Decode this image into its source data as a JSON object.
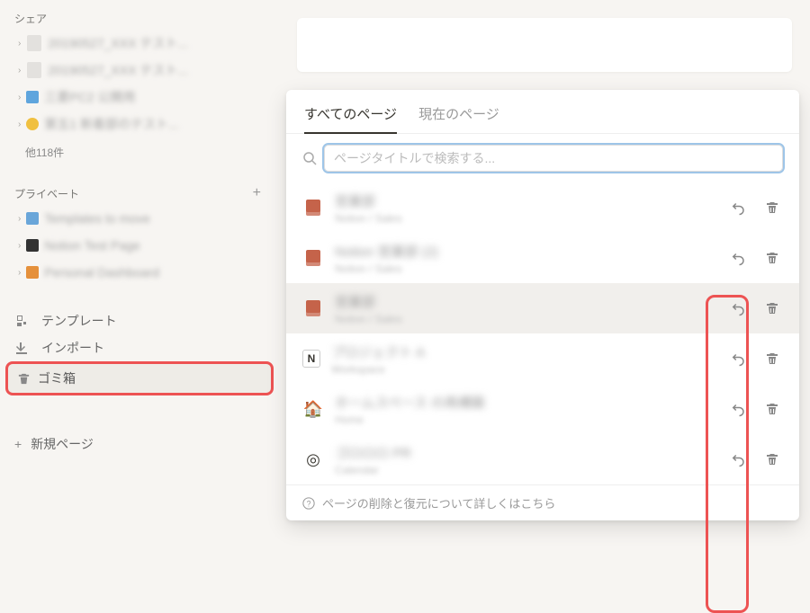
{
  "sidebar": {
    "share_label": "シェア",
    "share_items": [
      {
        "icon": "📄",
        "title": "20190527_XXX テスト..."
      },
      {
        "icon": "📄",
        "title": "20190527_XXX テスト..."
      },
      {
        "icon": "🟦",
        "title": "三菱PC2 公開用"
      },
      {
        "icon": "🟡",
        "title": "第五1 新着部のテスト..."
      }
    ],
    "other_count_label": "他118件",
    "private_label": "プライベート",
    "private_items": [
      {
        "icon": "🟦",
        "title": "Templates to move"
      },
      {
        "icon": "⬛",
        "title": "Notion Test Page"
      },
      {
        "icon": "🟧",
        "title": "Personal Dashboard"
      }
    ],
    "templates_label": "テンプレート",
    "import_label": "インポート",
    "trash_label": "ゴミ箱",
    "new_page_label": "新規ページ"
  },
  "popup": {
    "tabs": {
      "all_pages": "すべてのページ",
      "current_page": "現在のページ"
    },
    "search_placeholder": "ページタイトルで検索する...",
    "items": [
      {
        "icon": "brown",
        "title": "営業部",
        "sub": "Notion / Sales"
      },
      {
        "icon": "brown",
        "title": "Notion 営業部 (2)",
        "sub": "Notion / Sales"
      },
      {
        "icon": "brown",
        "title": "営業部",
        "sub": "Notion / Sales",
        "hover": true
      },
      {
        "icon": "notion",
        "title": "プロジェクト A",
        "sub": "Workspace"
      },
      {
        "icon": "house",
        "title": "ホームスペース の再構築",
        "sub": "Home"
      },
      {
        "icon": "target",
        "title": "ゴロロロ PR",
        "sub": "Calendar"
      }
    ],
    "footer_label": "ページの削除と復元について詳しくはこちら"
  }
}
